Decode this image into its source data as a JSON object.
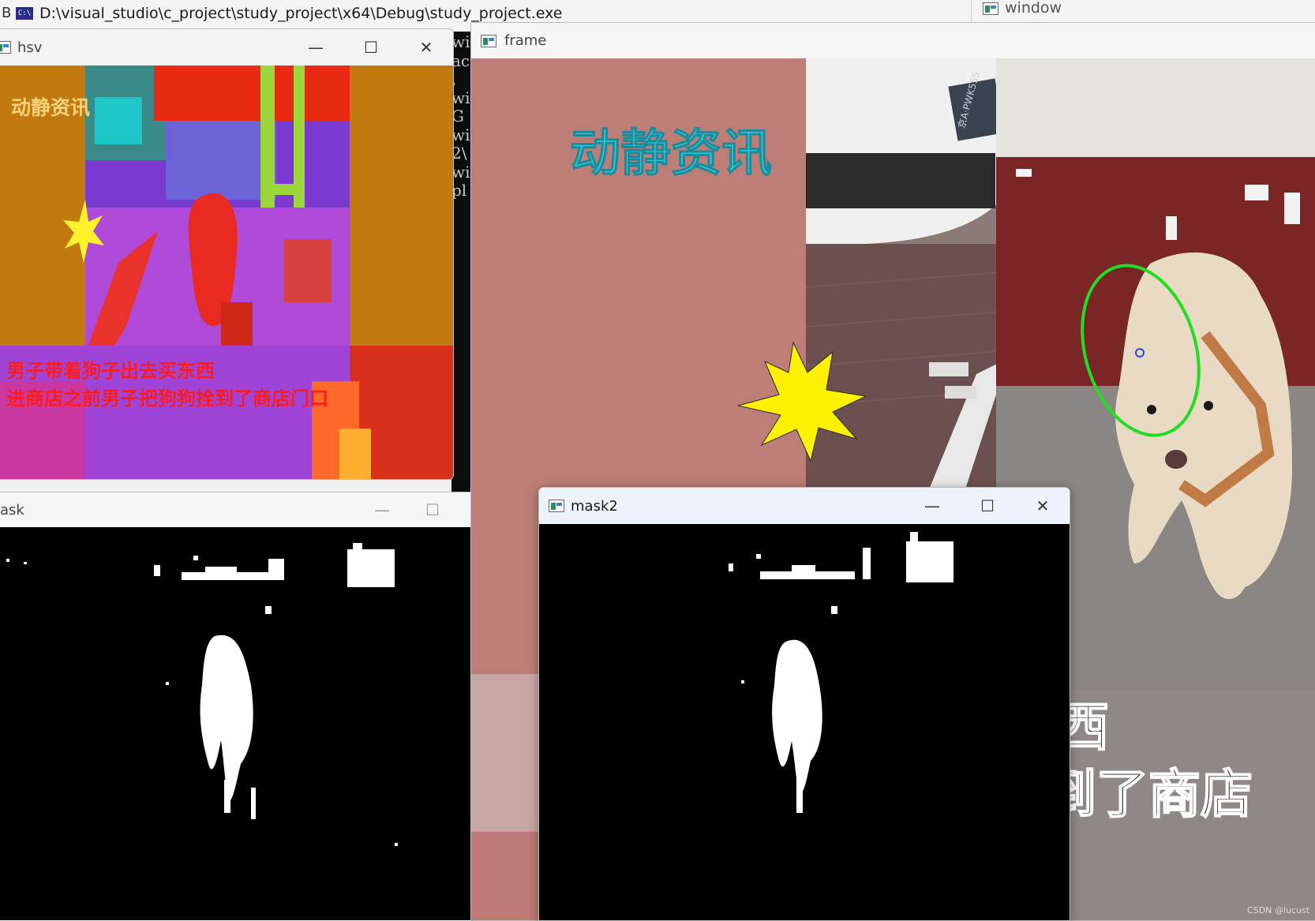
{
  "console": {
    "title": "D:\\visual_studio\\c_project\\study_project\\x64\\Debug\\study_project.exe",
    "icon": "console-app-icon",
    "edge_glyph": "B",
    "text_lines": [
      "wi",
      "ac",
      ",",
      "wi",
      "G",
      "wi",
      "2\\",
      "wi",
      "pl"
    ]
  },
  "windows": {
    "background_window_title": "window",
    "hsv_title": "hsv",
    "mask_title": "ask",
    "frame_title": "frame",
    "mask2_title": "mask2"
  },
  "window_controls": {
    "minimize": "—",
    "maximize": "☐",
    "close": "✕"
  },
  "hsv_view": {
    "logo_text": "动静资讯",
    "subtitle_line1": "男子带着狗子出去买东西",
    "subtitle_line2": "进商店之前男子把狗狗拴到了商店门口"
  },
  "frame_view": {
    "logo_text": "动静资讯",
    "caption_line1": "东西",
    "caption_line2": "拴到了商店",
    "plate_text": "京A·PWK555",
    "watermark": "CSDN @lucust"
  },
  "colors": {
    "tracking_ellipse": "#22dd22",
    "center_marker": "#3344dd",
    "logo": "#2cc9d8",
    "burst": "#ffee00"
  }
}
